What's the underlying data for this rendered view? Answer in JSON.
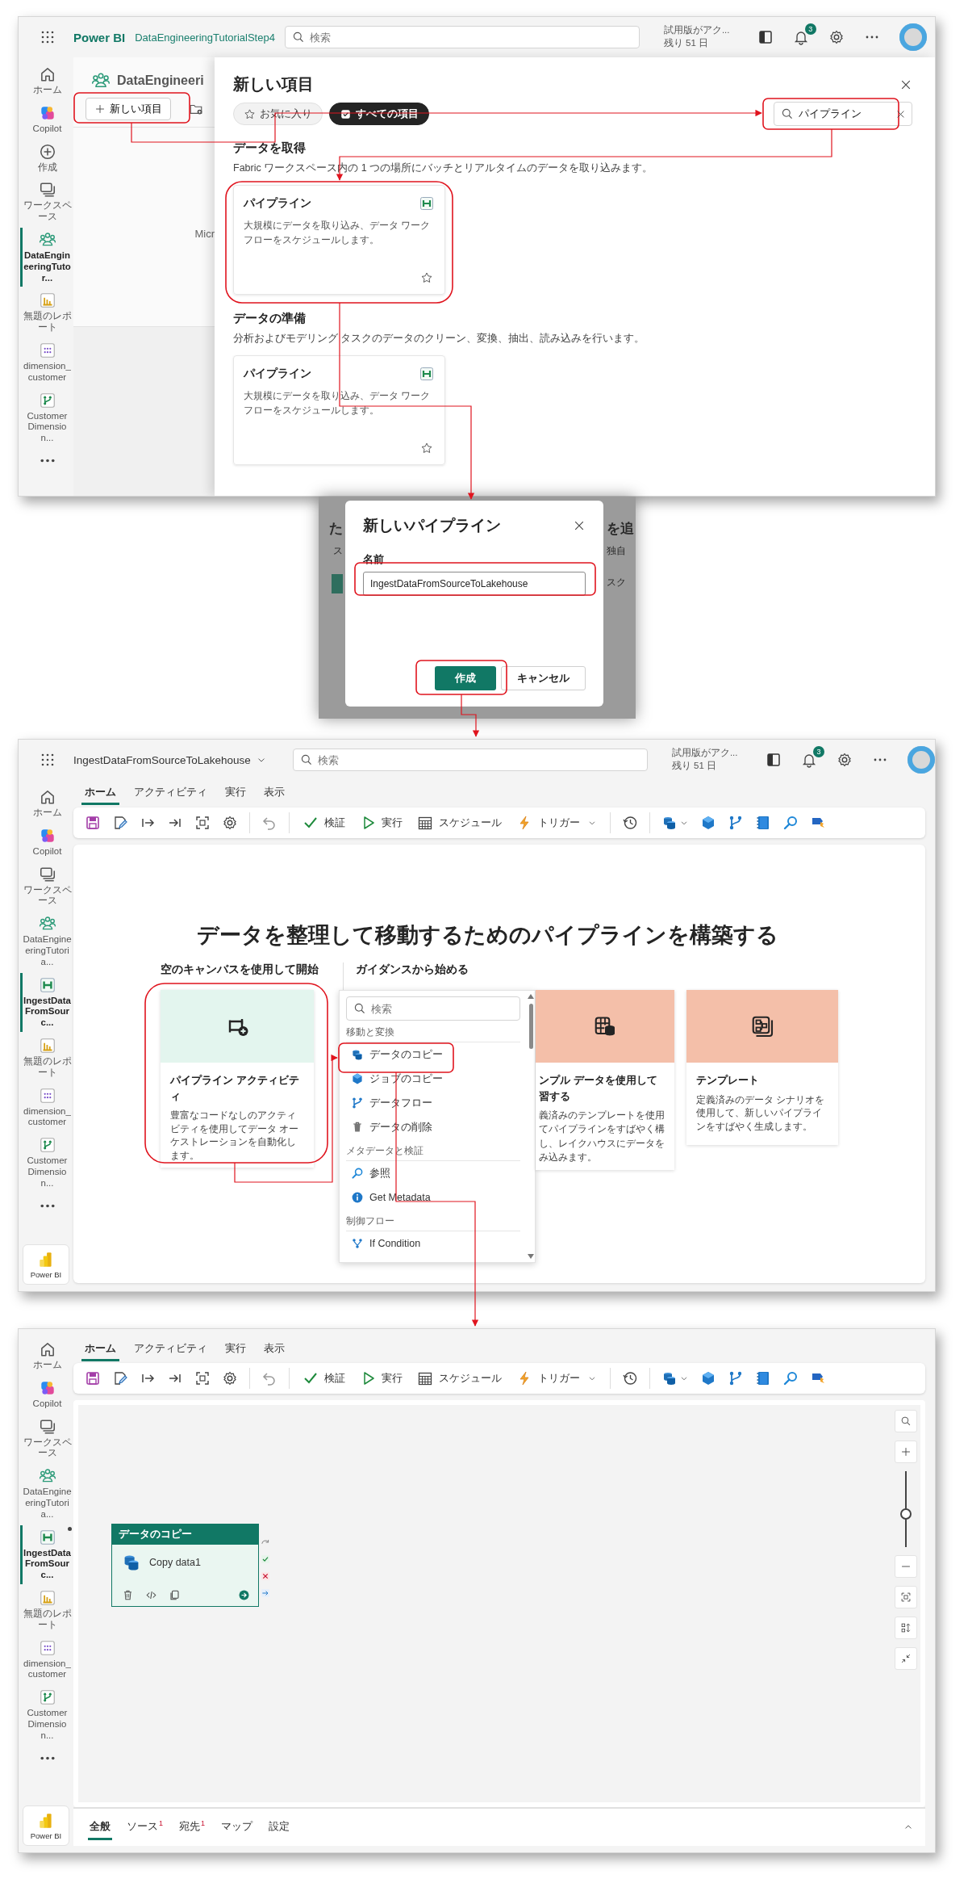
{
  "workspace_screen": {
    "top_bar": {
      "product": "Power BI",
      "workspace": "DataEngineeringTutorialStep4",
      "search": {
        "placeholder": "検索"
      },
      "trial": [
        "試用版がアク...",
        "残り 51 日"
      ],
      "notification_count": "3"
    },
    "sidebar": {
      "items": [
        {
          "kind": "home",
          "label": "ホーム",
          "selected": false
        },
        {
          "kind": "copilot",
          "label": "Copilot",
          "selected": false
        },
        {
          "kind": "create",
          "label": "作成",
          "selected": false
        },
        {
          "kind": "workspaces",
          "label": "ワークスペース",
          "selected": false
        },
        {
          "kind": "workspace",
          "label": "DataEngineeringTutor...",
          "selected": true
        },
        {
          "kind": "report",
          "label": "無題のレポート",
          "selected": false
        },
        {
          "kind": "model",
          "label": "dimension_customer",
          "selected": false
        },
        {
          "kind": "dataflow",
          "label": "Customer Dimension...",
          "selected": false
        },
        {
          "kind": "more",
          "selected": false
        }
      ]
    },
    "workspace": {
      "title": "DataEngineeri",
      "new_item_button": "新しい項目",
      "fragment": "Micr"
    },
    "new_item_panel": {
      "title": "新しい項目",
      "filters": [
        {
          "label": "お気に入り",
          "selected": false
        },
        {
          "label": "すべての項目",
          "selected": true
        }
      ],
      "search": {
        "value": "パイプライン"
      },
      "sections": [
        {
          "title": "データを取得",
          "description": "Fabric ワークスペース内の 1 つの場所にバッチとリアルタイムのデータを取り込みます。",
          "cards": [
            {
              "title": "パイプライン",
              "description": "大規模にデータを取り込み、データ ワークフローをスケジュールします。"
            }
          ]
        },
        {
          "title": "データの準備",
          "description": "分析およびモデリング タスクのデータのクリーン、変換、抽出、読み込みを行います。",
          "cards": [
            {
              "title": "パイプライン",
              "description": "大規模にデータを取り込み、データ ワークフローをスケジュールします。"
            }
          ]
        }
      ]
    }
  },
  "new_pipeline_dialog": {
    "backdrop_fragments": {
      "left": [
        "た",
        "ス"
      ],
      "right": [
        "を追",
        "独自",
        "スク"
      ]
    },
    "title": "新しいパイプライン",
    "name_field": {
      "label": "名前",
      "value": "IngestDataFromSourceToLakehouse"
    },
    "buttons": [
      {
        "label": "作成",
        "kind": "primary"
      },
      {
        "label": "キャンセル",
        "kind": "secondary"
      }
    ]
  },
  "pipeline_start_screen": {
    "top_bar": {
      "title": "IngestDataFromSourceToLakehouse",
      "search": {
        "placeholder": "検索"
      },
      "trial": [
        "試用版がアク...",
        "残り 51 日"
      ],
      "notification_count": "3"
    },
    "sidebar": {
      "items": [
        {
          "kind": "home",
          "label": "ホーム",
          "selected": false
        },
        {
          "kind": "copilot",
          "label": "Copilot",
          "selected": false
        },
        {
          "kind": "workspaces",
          "label": "ワークスペース",
          "selected": false
        },
        {
          "kind": "workspace",
          "label": "DataEngineeringTutoria...",
          "selected": false
        },
        {
          "kind": "pipeline",
          "label": "IngestDataFromSourc...",
          "selected": true
        },
        {
          "kind": "report",
          "label": "無題のレポート",
          "selected": false
        },
        {
          "kind": "model",
          "label": "dimension_customer",
          "selected": false
        },
        {
          "kind": "dataflow",
          "label": "Customer Dimension...",
          "selected": false
        },
        {
          "kind": "more",
          "selected": false
        }
      ]
    },
    "app_tile": "Power BI",
    "ribbon_tabs": [
      {
        "label": "ホーム",
        "selected": true
      },
      {
        "label": "アクティビティ",
        "selected": false
      },
      {
        "label": "実行",
        "selected": false
      },
      {
        "label": "表示",
        "selected": false
      }
    ],
    "toolbar": [
      {
        "kind": "save"
      },
      {
        "kind": "edit"
      },
      {
        "kind": "step-into"
      },
      {
        "kind": "step-end"
      },
      {
        "kind": "select"
      },
      {
        "kind": "settings"
      },
      {
        "kind": "separator"
      },
      {
        "kind": "undo"
      },
      {
        "kind": "separator"
      },
      {
        "kind": "validate",
        "label": "検証"
      },
      {
        "kind": "run",
        "label": "実行"
      },
      {
        "kind": "schedule",
        "label": "スケジュール"
      },
      {
        "kind": "trigger",
        "label": "トリガー"
      },
      {
        "kind": "separator"
      },
      {
        "kind": "history"
      },
      {
        "kind": "separator"
      },
      {
        "kind": "copy-data"
      },
      {
        "kind": "copy-job"
      },
      {
        "kind": "dataflow"
      },
      {
        "kind": "notebook"
      },
      {
        "kind": "lookup"
      },
      {
        "kind": "teams"
      }
    ],
    "heading": "データを整理して移動するためのパイプラインを構築する",
    "blank_column": {
      "title": "空のキャンバスを使用して開始",
      "card": {
        "title": "パイプライン アクティビティ",
        "description": "豊富なコードなしのアクティビティを使用してデータ オーケストレーションを自動化します。"
      }
    },
    "guided_column": {
      "title": "ガイダンスから始める",
      "menu": {
        "search": {
          "placeholder": "検索"
        },
        "groups": [
          {
            "title": "移動と変換",
            "items": [
              {
                "kind": "copy-data",
                "label": "データのコピー"
              },
              {
                "kind": "copy-job",
                "label": "ジョブのコピー"
              },
              {
                "kind": "dataflow",
                "label": "データフロー"
              },
              {
                "kind": "delete",
                "label": "データの削除"
              }
            ]
          },
          {
            "title": "メタデータと検証",
            "items": [
              {
                "kind": "lookup",
                "label": "参照"
              },
              {
                "kind": "get-metadata",
                "label": "Get Metadata"
              }
            ]
          },
          {
            "title": "制御フロー",
            "items": [
              {
                "kind": "if-condition",
                "label": "If Condition"
              }
            ]
          }
        ]
      },
      "sample_card": {
        "title_lines": [
          "ンプル データを使用して",
          "習する"
        ],
        "description_lines": [
          "義済みのテンプレートを使用",
          "てパイプラインをすばやく構",
          "し、レイクハウスにデータを",
          "み込みます。"
        ]
      },
      "template_card": {
        "title": "テンプレート",
        "description": "定義済みのデータ シナリオを使用して、新しいパイプラインをすばやく生成します。"
      }
    }
  },
  "pipeline_canvas_screen": {
    "sidebar": {
      "items": [
        {
          "kind": "home",
          "label": "ホーム",
          "selected": false,
          "modified": false
        },
        {
          "kind": "copilot",
          "label": "Copilot",
          "selected": false,
          "modified": false
        },
        {
          "kind": "workspaces",
          "label": "ワークスペース",
          "selected": false,
          "modified": false
        },
        {
          "kind": "workspace",
          "label": "DataEngineeringTutoria...",
          "selected": false,
          "modified": false
        },
        {
          "kind": "pipeline",
          "label": "IngestDataFromSourc...",
          "selected": true,
          "modified": true
        },
        {
          "kind": "report",
          "label": "無題のレポート",
          "selected": false,
          "modified": false
        },
        {
          "kind": "model",
          "label": "dimension_customer",
          "selected": false,
          "modified": false
        },
        {
          "kind": "dataflow",
          "label": "Customer Dimension...",
          "selected": false,
          "modified": false
        },
        {
          "kind": "more",
          "selected": false,
          "modified": false
        }
      ]
    },
    "app_tile": "Power BI",
    "ribbon_tabs": [
      {
        "label": "ホーム",
        "selected": true
      },
      {
        "label": "アクティビティ",
        "selected": false
      },
      {
        "label": "実行",
        "selected": false
      },
      {
        "label": "表示",
        "selected": false
      }
    ],
    "toolbar": [
      {
        "kind": "save"
      },
      {
        "kind": "edit"
      },
      {
        "kind": "step-into"
      },
      {
        "kind": "step-end"
      },
      {
        "kind": "select"
      },
      {
        "kind": "settings"
      },
      {
        "kind": "separator"
      },
      {
        "kind": "undo"
      },
      {
        "kind": "separator"
      },
      {
        "kind": "validate",
        "label": "検証"
      },
      {
        "kind": "run",
        "label": "実行"
      },
      {
        "kind": "schedule",
        "label": "スケジュール"
      },
      {
        "kind": "trigger",
        "label": "トリガー"
      },
      {
        "kind": "separator"
      },
      {
        "kind": "history"
      },
      {
        "kind": "separator"
      },
      {
        "kind": "copy-data"
      },
      {
        "kind": "copy-job"
      },
      {
        "kind": "dataflow"
      },
      {
        "kind": "notebook"
      },
      {
        "kind": "lookup"
      },
      {
        "kind": "teams"
      }
    ],
    "activity": {
      "title": "データのコピー",
      "name": "Copy data1"
    },
    "zoom_slider": {
      "level": 0.42
    },
    "bottom_tabs": [
      {
        "label": "全般",
        "selected": true
      },
      {
        "label": "ソース",
        "badge": "1",
        "selected": false
      },
      {
        "label": "宛先",
        "badge": "1",
        "selected": false
      },
      {
        "label": "マップ",
        "selected": false
      },
      {
        "label": "設定",
        "selected": false
      }
    ]
  }
}
